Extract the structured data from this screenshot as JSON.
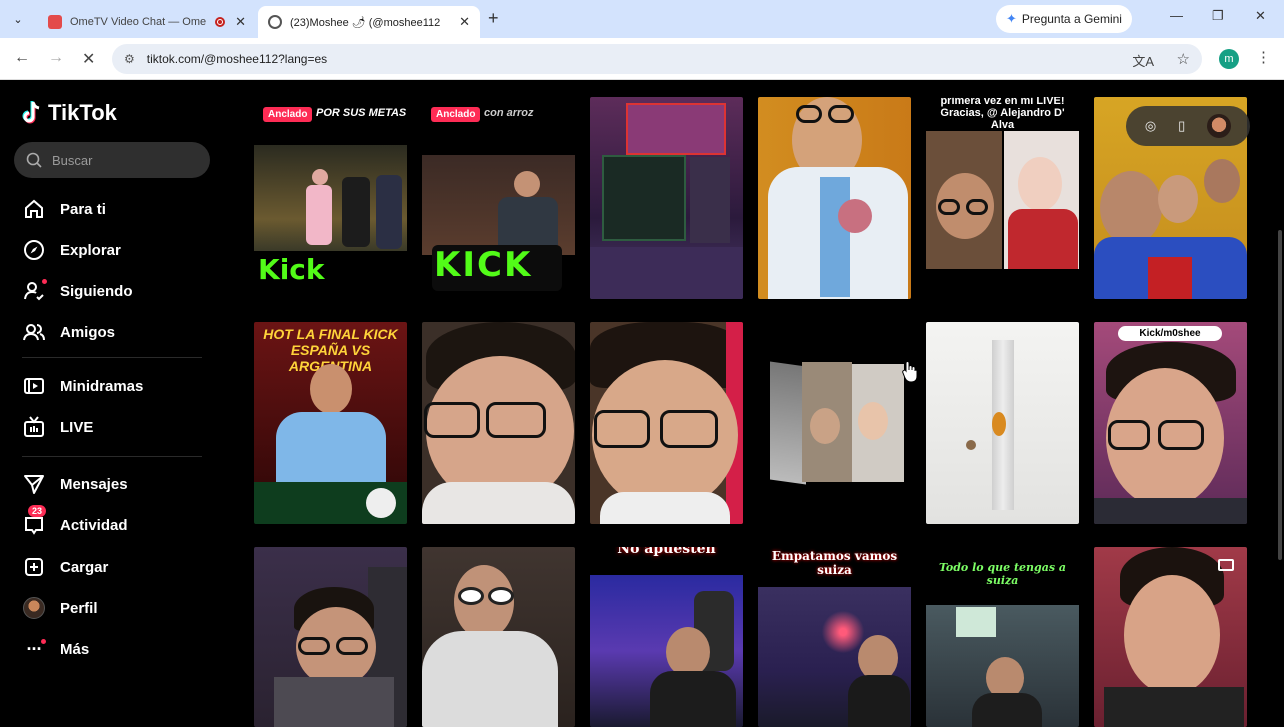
{
  "browser": {
    "tabs": [
      {
        "title": "OmeTV Video Chat — Ome",
        "active": false,
        "recording": true
      },
      {
        "title": "(23)Moshee 🌶 (@moshee112",
        "active": true
      }
    ],
    "new_tab": "+",
    "gemini_label": "Pregunta a Gemini",
    "url": "tiktok.com/@moshee112?lang=es",
    "profile_initial": "m"
  },
  "tiktok": {
    "logo_text": "TikTok",
    "search_placeholder": "Buscar",
    "nav": [
      {
        "label": "Para ti",
        "icon": "home-icon"
      },
      {
        "label": "Explorar",
        "icon": "compass-icon"
      },
      {
        "label": "Siguiendo",
        "icon": "following-icon"
      },
      {
        "label": "Amigos",
        "icon": "friends-icon"
      },
      {
        "label": "Minidramas",
        "icon": "minidramas-icon"
      },
      {
        "label": "LIVE",
        "icon": "live-icon"
      },
      {
        "label": "Mensajes",
        "icon": "messages-icon"
      },
      {
        "label": "Actividad",
        "icon": "activity-icon",
        "badge": "23"
      },
      {
        "label": "Cargar",
        "icon": "upload-icon"
      },
      {
        "label": "Perfil",
        "icon": "profile-avatar"
      },
      {
        "label": "Más",
        "icon": "more-icon"
      }
    ]
  },
  "videos": [
    {
      "pinned": "Anclado",
      "caption": "POR SUS METAS",
      "overlay": "Kick"
    },
    {
      "pinned": "Anclado",
      "caption": "con arroz",
      "overlay": "KICK"
    },
    {
      "caption": ""
    },
    {
      "caption": ""
    },
    {
      "caption": "primera vez en mi LIVE! Gracias, @ Alejandro D' Alva"
    },
    {
      "caption": ""
    },
    {
      "caption": "HOT LA FINAL KICK ESPAÑA VS ARGENTINA"
    },
    {
      "caption": ""
    },
    {
      "caption": ""
    },
    {
      "caption": ""
    },
    {
      "caption": ""
    },
    {
      "caption": "Kick/m0shee"
    },
    {
      "caption": ""
    },
    {
      "caption": ""
    },
    {
      "caption": "No apuesten"
    },
    {
      "caption": "Empatamos vamos suiza"
    },
    {
      "caption": "Todo lo que tengas a suiza"
    },
    {
      "caption": ""
    }
  ],
  "colors": {
    "accent": "#fe2c55",
    "kick_green": "#52fc18",
    "background": "#000000"
  }
}
